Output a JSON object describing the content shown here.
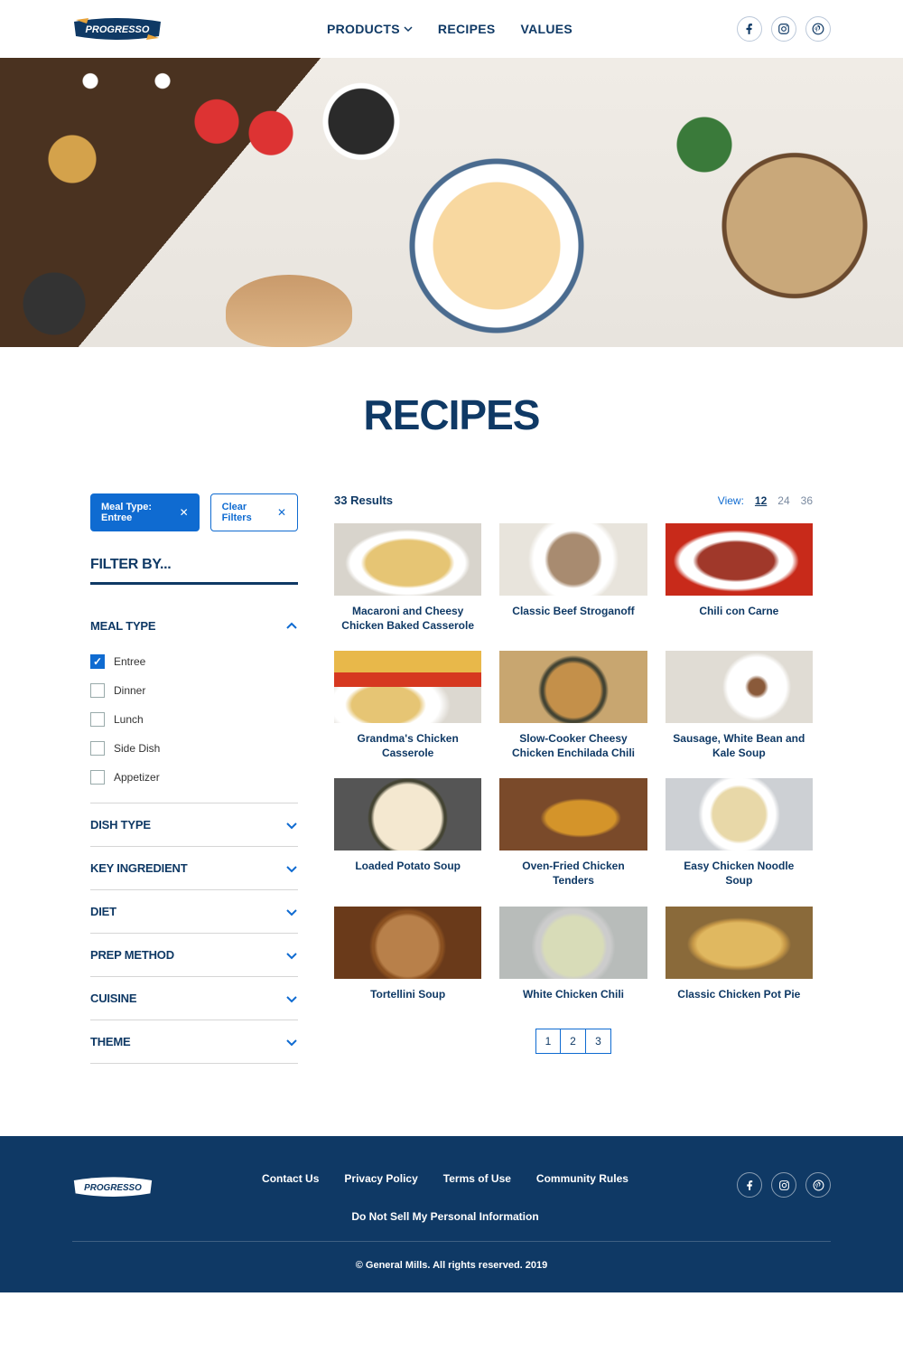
{
  "brand": "PROGRESSO",
  "nav": {
    "products": "PRODUCTS",
    "recipes": "RECIPES",
    "values": "VALUES"
  },
  "page_title": "RECIPES",
  "chips": {
    "active": "Meal Type: Entree",
    "clear": "Clear Filters"
  },
  "filter_title": "FILTER BY...",
  "filter_groups": {
    "meal_type": {
      "label": "MEAL TYPE",
      "options": {
        "entree": "Entree",
        "dinner": "Dinner",
        "lunch": "Lunch",
        "side_dish": "Side Dish",
        "appetizer": "Appetizer"
      }
    },
    "dish_type": "DISH TYPE",
    "key_ingredient": "KEY INGREDIENT",
    "diet": "DIET",
    "prep_method": "PREP METHOD",
    "cuisine": "CUISINE",
    "theme": "THEME"
  },
  "results": {
    "count": "33 Results",
    "view_label": "View:",
    "views": {
      "v12": "12",
      "v24": "24",
      "v36": "36"
    }
  },
  "recipes": {
    "r1": "Macaroni and Cheesy Chicken Baked Casserole",
    "r2": "Classic Beef Stroganoff",
    "r3": "Chili con Carne",
    "r4": "Grandma's Chicken Casserole",
    "r5": "Slow-Cooker Cheesy Chicken Enchilada Chili",
    "r6": "Sausage, White Bean and Kale Soup",
    "r7": "Loaded Potato Soup",
    "r8": "Oven-Fried Chicken Tenders",
    "r9": "Easy Chicken Noodle Soup",
    "r10": "Tortellini Soup",
    "r11": "White Chicken Chili",
    "r12": "Classic Chicken Pot Pie"
  },
  "pagination": {
    "p1": "1",
    "p2": "2",
    "p3": "3"
  },
  "footer": {
    "contact": "Contact Us",
    "privacy": "Privacy Policy",
    "terms": "Terms of Use",
    "community": "Community Rules",
    "do_not_sell": "Do Not Sell My Personal Information",
    "copyright": "© General Mills. All rights reserved. 2019"
  }
}
